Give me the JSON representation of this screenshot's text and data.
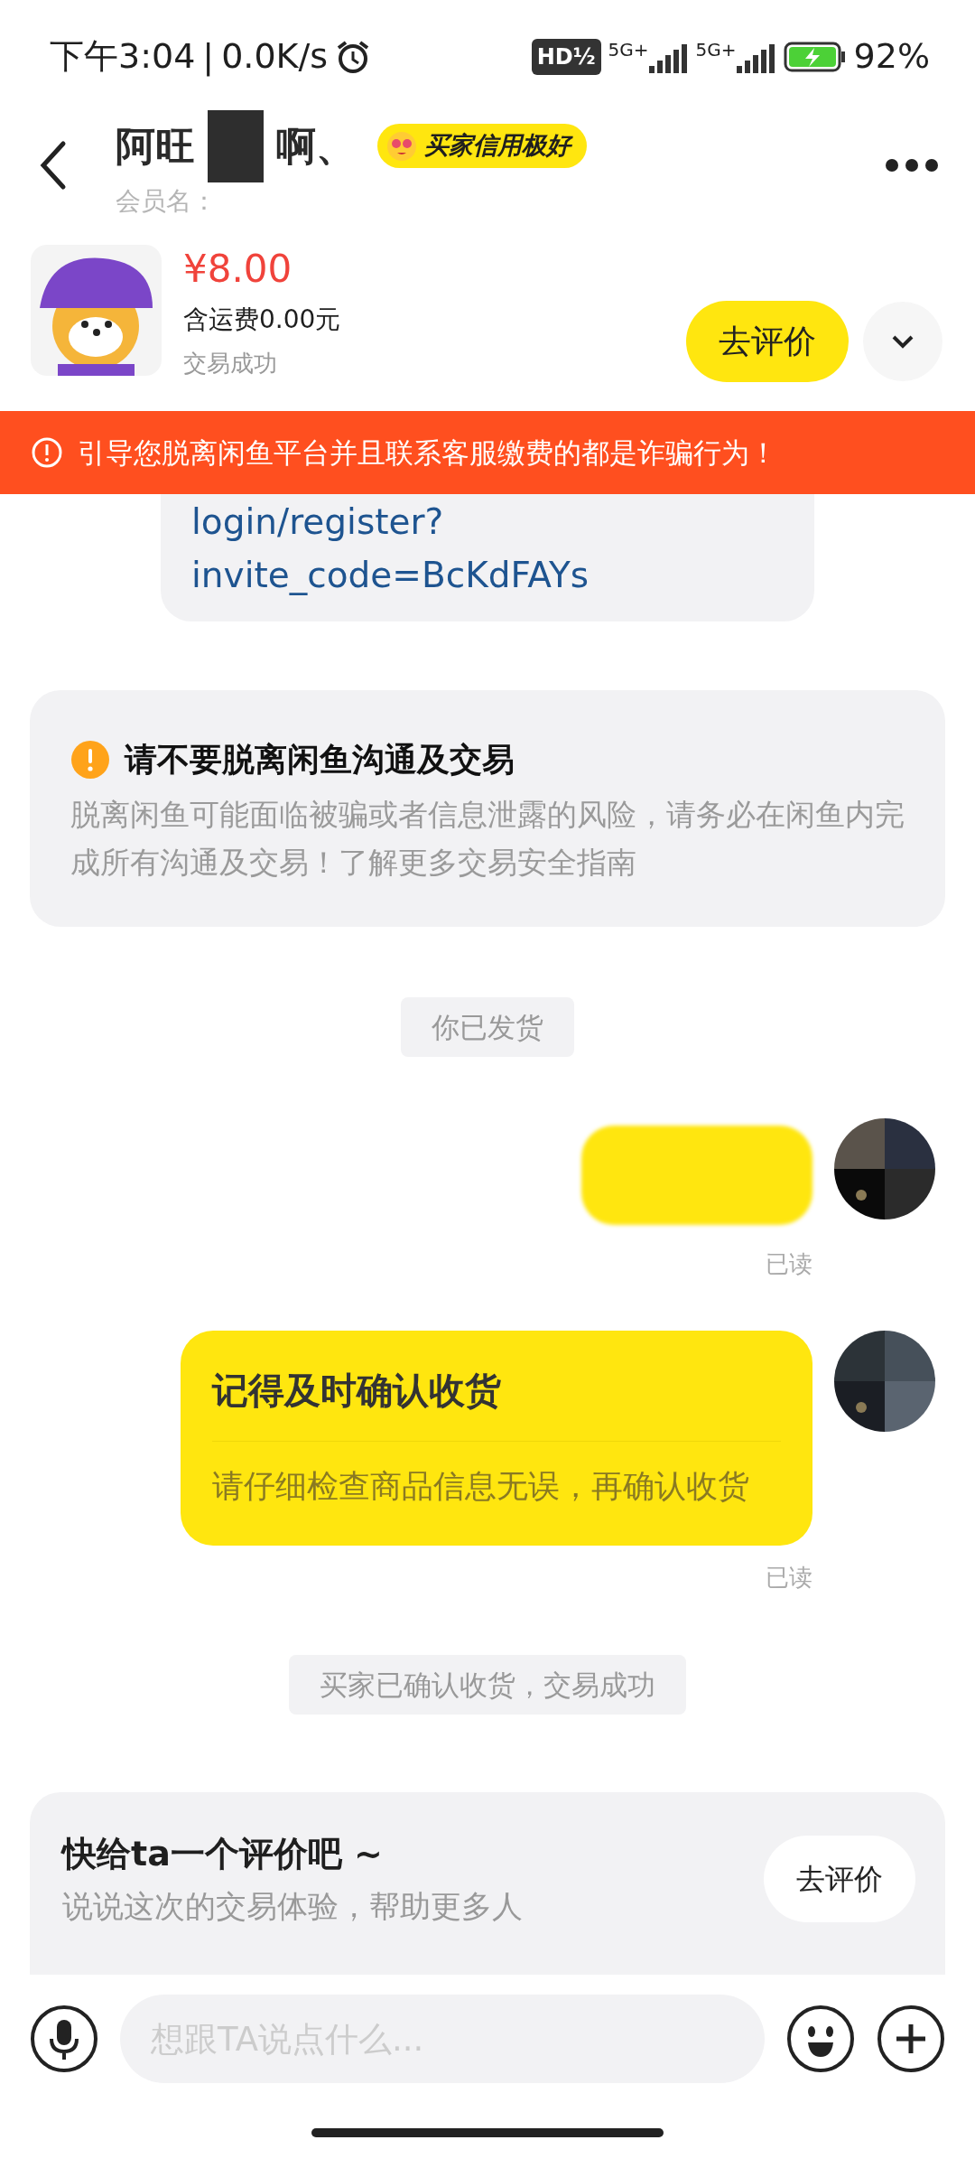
{
  "status_bar": {
    "time": "下午3:04",
    "separator": "|",
    "speed": "0.0K/s",
    "hd_badge": "HD½",
    "network_1": "5G+",
    "network_2": "5G+",
    "battery": "92%"
  },
  "header": {
    "title_start": "阿旺",
    "title_end": "啊、",
    "redacted": true,
    "badge": "买家信用极好",
    "member_label": "会员名："
  },
  "product": {
    "price": "¥8.00",
    "shipping": "含运费0.00元",
    "status": "交易成功",
    "review_button": "去评价"
  },
  "banner": "引导您脱离闲鱼平台并且联系客服缴费的都是诈骗行为！",
  "messages": [
    {
      "kind": "link",
      "lines": [
        "login/register?",
        "invite_code=BcKdFAYs"
      ]
    },
    {
      "kind": "notice",
      "title": "请不要脱离闲鱼沟通及交易",
      "body": "脱离闲鱼可能面临被骗或者信息泄露的风险，请务必在闲鱼内完成所有沟通及交易！",
      "link": "了解更多交易安全指南"
    },
    {
      "kind": "system",
      "text": "你已发货"
    },
    {
      "kind": "bubble",
      "redacted": true,
      "read": "已读"
    },
    {
      "kind": "card",
      "title": "记得及时确认收货",
      "body": "请仔细检查商品信息无误，再确认收货",
      "read": "已读"
    },
    {
      "kind": "system",
      "text": "买家已确认收货，交易成功"
    }
  ],
  "review_prompt": {
    "title": "快给ta一个评价吧 ~",
    "subtitle": "说说这次的交易体验，帮助更多人",
    "button": "去评价"
  },
  "composer": {
    "placeholder": "想跟TA说点什么..."
  }
}
